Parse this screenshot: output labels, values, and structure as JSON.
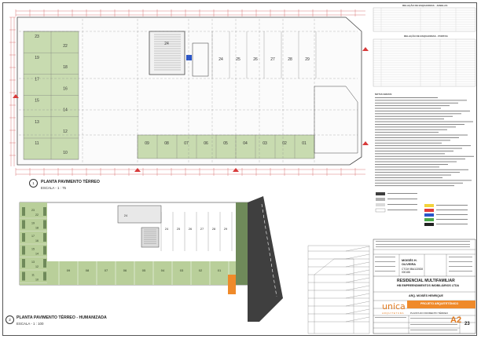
{
  "sheet": {
    "plan1": {
      "title": "PLANTA PAVIMENTO TÉRREO",
      "scale": "ESCALA - 1 : 75",
      "number": "1"
    },
    "plan2": {
      "title": "PLANTA PAVIMENTO TÉRREO - HUMANIZADA",
      "scale": "ESCALA - 1 : 100",
      "number": "2"
    },
    "tables": {
      "windows_title": "RELAÇÃO DE ESQUADRIAS - JANELAS",
      "doors_title": "RELAÇÃO DE ESQUADRIAS - PORTAS",
      "notes_title": "NOTAS GERAIS:"
    },
    "parking_numbers_top": [
      "21",
      "20",
      "19",
      "18",
      "17",
      "16",
      "15",
      "14",
      "13",
      "12",
      "11",
      "10",
      "09",
      "08",
      "07",
      "06",
      "05",
      "04",
      "03",
      "02",
      "01",
      "24",
      "25",
      "26",
      "27",
      "28",
      "29",
      "22",
      "23"
    ],
    "plan1_spots": {
      "left_col_a": [
        "23",
        "19",
        "17",
        "15",
        "13",
        "11"
      ],
      "left_col_b": [
        "22",
        "18",
        "16",
        "14",
        "12",
        "10"
      ],
      "top_row": [
        "24",
        "25",
        "26",
        "27",
        "28",
        "29"
      ],
      "bottom_row": [
        "09",
        "08",
        "07",
        "06",
        "05",
        "04",
        "03",
        "02",
        "01"
      ]
    },
    "plan2_spots": {
      "left": [
        "23",
        "22",
        "19",
        "18",
        "17",
        "16",
        "15",
        "14",
        "13",
        "12",
        "11",
        "10"
      ],
      "top": [
        "24",
        "25",
        "26",
        "27",
        "28",
        "29"
      ],
      "bottom": [
        "09",
        "08",
        "07",
        "06",
        "05",
        "04",
        "03",
        "02",
        "01"
      ]
    }
  },
  "title_block": {
    "owner_name": "MOISÉS H.\nOLIVEIRA",
    "owner_cpf": "CTCM 5BA1135D8\n000188",
    "project_title": "RESIDENCIAL MULTIFAMILIAR",
    "company": "HB EMPREENDIMENTOS IMOBILIÁRIOS LTDA",
    "responsible": "ARQ. MOISÉS HENRIQUE",
    "project_type": "PROJETO ARQUITETÔNICO",
    "sheet_content": "PLANTA DO PAVIMENTO TÉRREO",
    "format": "A2",
    "sheet_number": "23",
    "logo_name": "unica",
    "logo_sub": "ARQUITETURA"
  },
  "colors": {
    "grass": "#b9cf9a",
    "grass_dark": "#6f8a5a",
    "asphalt": "#3f3f3f",
    "stripe": "#ef8a2a",
    "accessible": "#2a56c9",
    "red_marks": "#d83a3a",
    "wall": "#444444",
    "dim_red": "#cc4444"
  }
}
